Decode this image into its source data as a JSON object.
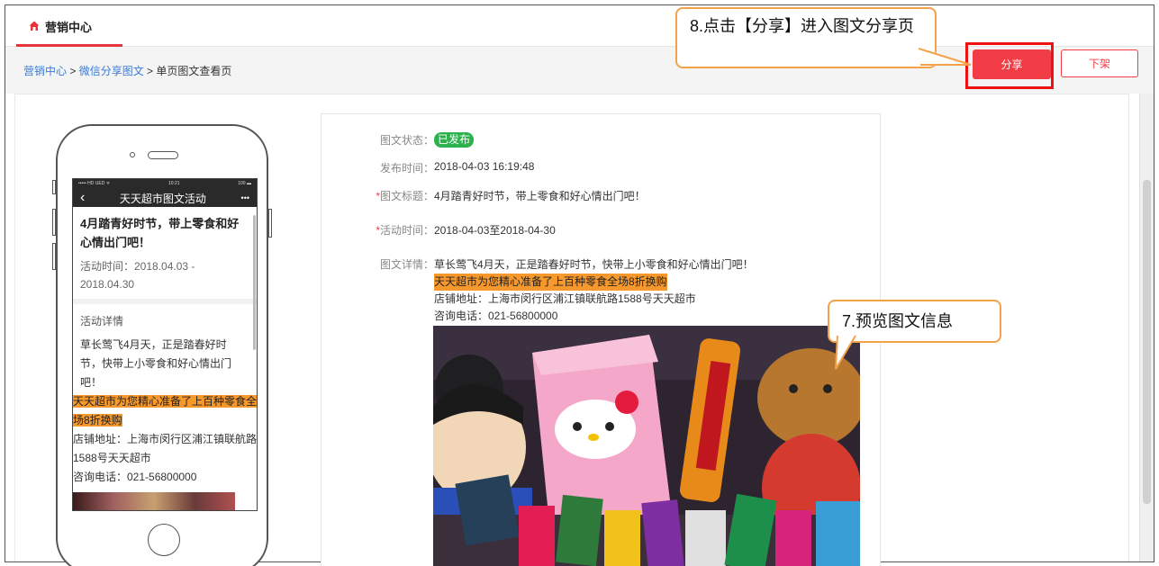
{
  "topbar": {
    "tab_label": "营销中心"
  },
  "breadcrumb": {
    "item1": "营销中心",
    "sep1": " > ",
    "item2": "微信分享图文",
    "sep2": " > ",
    "current": "单页图文查看页"
  },
  "actions": {
    "share_label": "分享",
    "offline_label": "下架"
  },
  "callouts": {
    "share_tip": "8.点击【分享】进入图文分享页",
    "preview_tip": "7.预览图文信息"
  },
  "phone": {
    "status_left": "••••• HD UED ᯤ",
    "status_time": "10:21",
    "status_right": "100 ▬",
    "back": "‹",
    "nav_title": "天天超市图文活动",
    "more": "•••",
    "title": "4月踏青好时节，带上零食和好心情出门吧！",
    "time_text": "活动时间：2018.04.03 - 2018.04.30",
    "detail_label": "活动详情",
    "body_text": "草长莺飞4月天，正是踏春好时节，快带上小零食和好心情出门吧！",
    "highlight": "天天超市为您精心准备了上百种零食全场8折换购",
    "address": "店铺地址：上海市闵行区浦江镇联航路1588号天天超市",
    "phone_line": "咨询电话：021-56800000"
  },
  "detail": {
    "status_label": "图文状态：",
    "status_value": "已发布",
    "publish_label": "发布时间：",
    "publish_value": "2018-04-03 16:19:48",
    "title_label": "图文标题：",
    "title_value": "4月踏青好时节，带上零食和好心情出门吧！",
    "activity_label": "活动时间：",
    "activity_value": "2018-04-03至2018-04-30",
    "content_label": "图文详情：",
    "content_line1": "草长莺飞4月天，正是踏春好时节，快带上小零食和好心情出门吧！",
    "content_highlight": "天天超市为您精心准备了上百种零食全场8折换购",
    "content_address": "店铺地址：上海市闵行区浦江镇联航路1588号天天超市",
    "content_phone": "咨询电话：021-56800000",
    "required_mark": "*"
  },
  "colors": {
    "accent": "#f23d46",
    "highlight": "#f7982c",
    "callout_border": "#f4a24a",
    "badge": "#2bb24c",
    "link": "#3a7bd5"
  }
}
